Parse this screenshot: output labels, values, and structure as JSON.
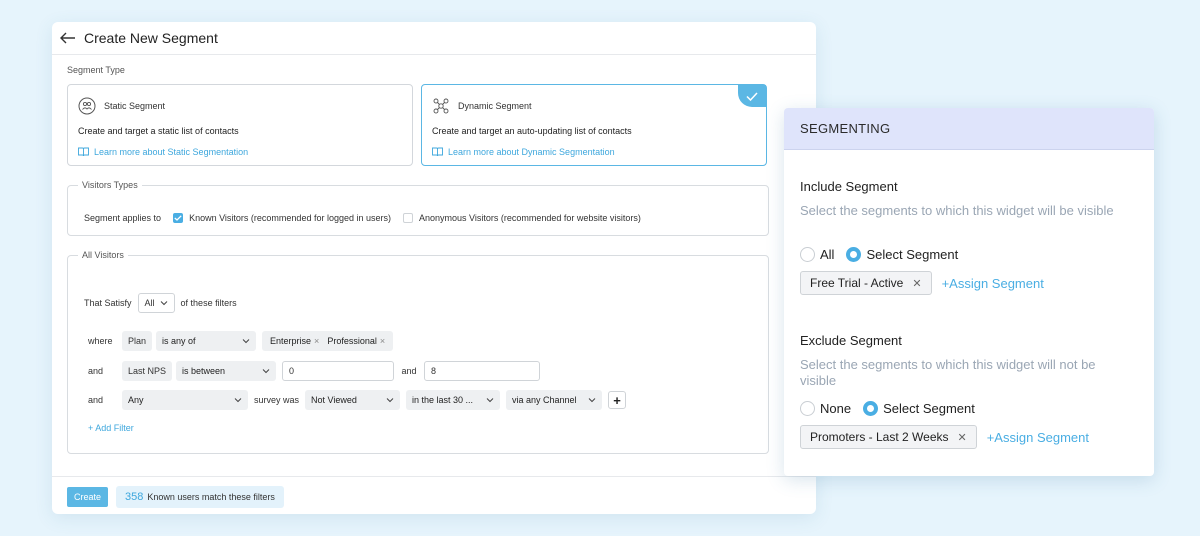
{
  "header": {
    "title": "Create New Segment"
  },
  "segment_type": {
    "label": "Segment Type",
    "static": {
      "name": "Static Segment",
      "description": "Create and target a static list of contacts",
      "link": "Learn more about Static Segmentation"
    },
    "dynamic": {
      "name": "Dynamic Segment",
      "description": "Create and target an auto-updating list of contacts",
      "link": "Learn more about Dynamic Segmentation"
    }
  },
  "visitors_types": {
    "legend": "Visitors Types",
    "applies_label": "Segment applies to",
    "known": "Known Visitors (recommended for logged in users)",
    "anonymous": "Anonymous Visitors (recommended for website visitors)"
  },
  "all_visitors": {
    "legend": "All Visitors",
    "that_satisfy": "That Satisfy",
    "match_value": "All",
    "of_filters": "of these filters",
    "filters": [
      {
        "conj": "where",
        "field": "Plan",
        "operator": "is any of",
        "chips": [
          "Enterprise",
          "Professional"
        ]
      },
      {
        "conj": "and",
        "field": "Last NPS",
        "operator": "is between",
        "from": "0",
        "between_and": "and",
        "to": "8"
      },
      {
        "conj": "and",
        "survey": "Any",
        "survey_was": "survey was",
        "status": "Not Viewed",
        "period": "in the last 30 ...",
        "channel": "via any Channel"
      }
    ],
    "add_filter": "+ Add Filter",
    "plus": "+"
  },
  "footer": {
    "create": "Create",
    "count": "358",
    "match_text": "Known users match these filters"
  },
  "panel": {
    "title": "SEGMENTING",
    "include": {
      "title": "Include Segment",
      "description": "Select the segments to which this widget will be visible",
      "opt1": "All",
      "opt2": "Select Segment",
      "chip": "Free Trial - Active",
      "assign": "+Assign Segment"
    },
    "exclude": {
      "title": "Exclude Segment",
      "description": "Select the segments to which this widget will not be visible",
      "opt1": "None",
      "opt2": "Select Segment",
      "chip": "Promoters - Last 2 Weeks",
      "assign": "+Assign Segment"
    }
  },
  "icons": {
    "back": "arrow-left-icon",
    "static": "people-icon",
    "dynamic": "network-icon",
    "book": "book-icon",
    "check": "check-icon",
    "chevron": "chevron-down-icon",
    "close": "close-icon"
  },
  "colors": {
    "accent": "#4aaee3",
    "page_bg": "#e6f4fc",
    "panel_head": "#dfe4fb"
  }
}
